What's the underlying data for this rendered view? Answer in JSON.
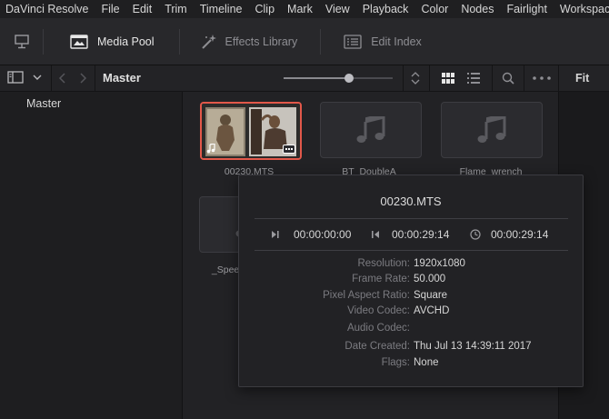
{
  "menu": [
    "DaVinci Resolve",
    "File",
    "Edit",
    "Trim",
    "Timeline",
    "Clip",
    "Mark",
    "View",
    "Playback",
    "Color",
    "Nodes",
    "Fairlight",
    "Workspace"
  ],
  "toolbar": {
    "media_pool": "Media Pool",
    "effects_library": "Effects Library",
    "edit_index": "Edit Index"
  },
  "panelbar": {
    "bin_title": "Master",
    "zoom_value": 0.6,
    "fit": "Fit"
  },
  "sidebar": {
    "items": [
      "Master"
    ]
  },
  "clips": [
    {
      "label": "00230.MTS",
      "type": "video"
    },
    {
      "label": "BT_DoubleA",
      "type": "audio"
    },
    {
      "label": "Flame_wrench",
      "type": "audio"
    },
    {
      "label": "_Speed",
      "type": "audio"
    }
  ],
  "popup": {
    "title": "00230.MTS",
    "timecodes": {
      "start": "00:00:00:00",
      "end": "00:00:29:14",
      "duration": "00:00:29:14"
    },
    "meta": [
      {
        "key": "Resolution:",
        "value": "1920x1080"
      },
      {
        "key": "Frame Rate:",
        "value": "50.000"
      },
      {
        "key": "Pixel Aspect Ratio:",
        "value": "Square"
      },
      {
        "key": "Video Codec:",
        "value": "AVCHD"
      },
      {
        "key": "Audio Codec:",
        "value": ""
      },
      {
        "key": "Date Created:",
        "value": "Thu Jul 13 14:39:11 2017"
      },
      {
        "key": "Flags:",
        "value": "None"
      }
    ]
  },
  "colors": {
    "selection": "#e2584a",
    "accent": "#d6d6d6"
  }
}
